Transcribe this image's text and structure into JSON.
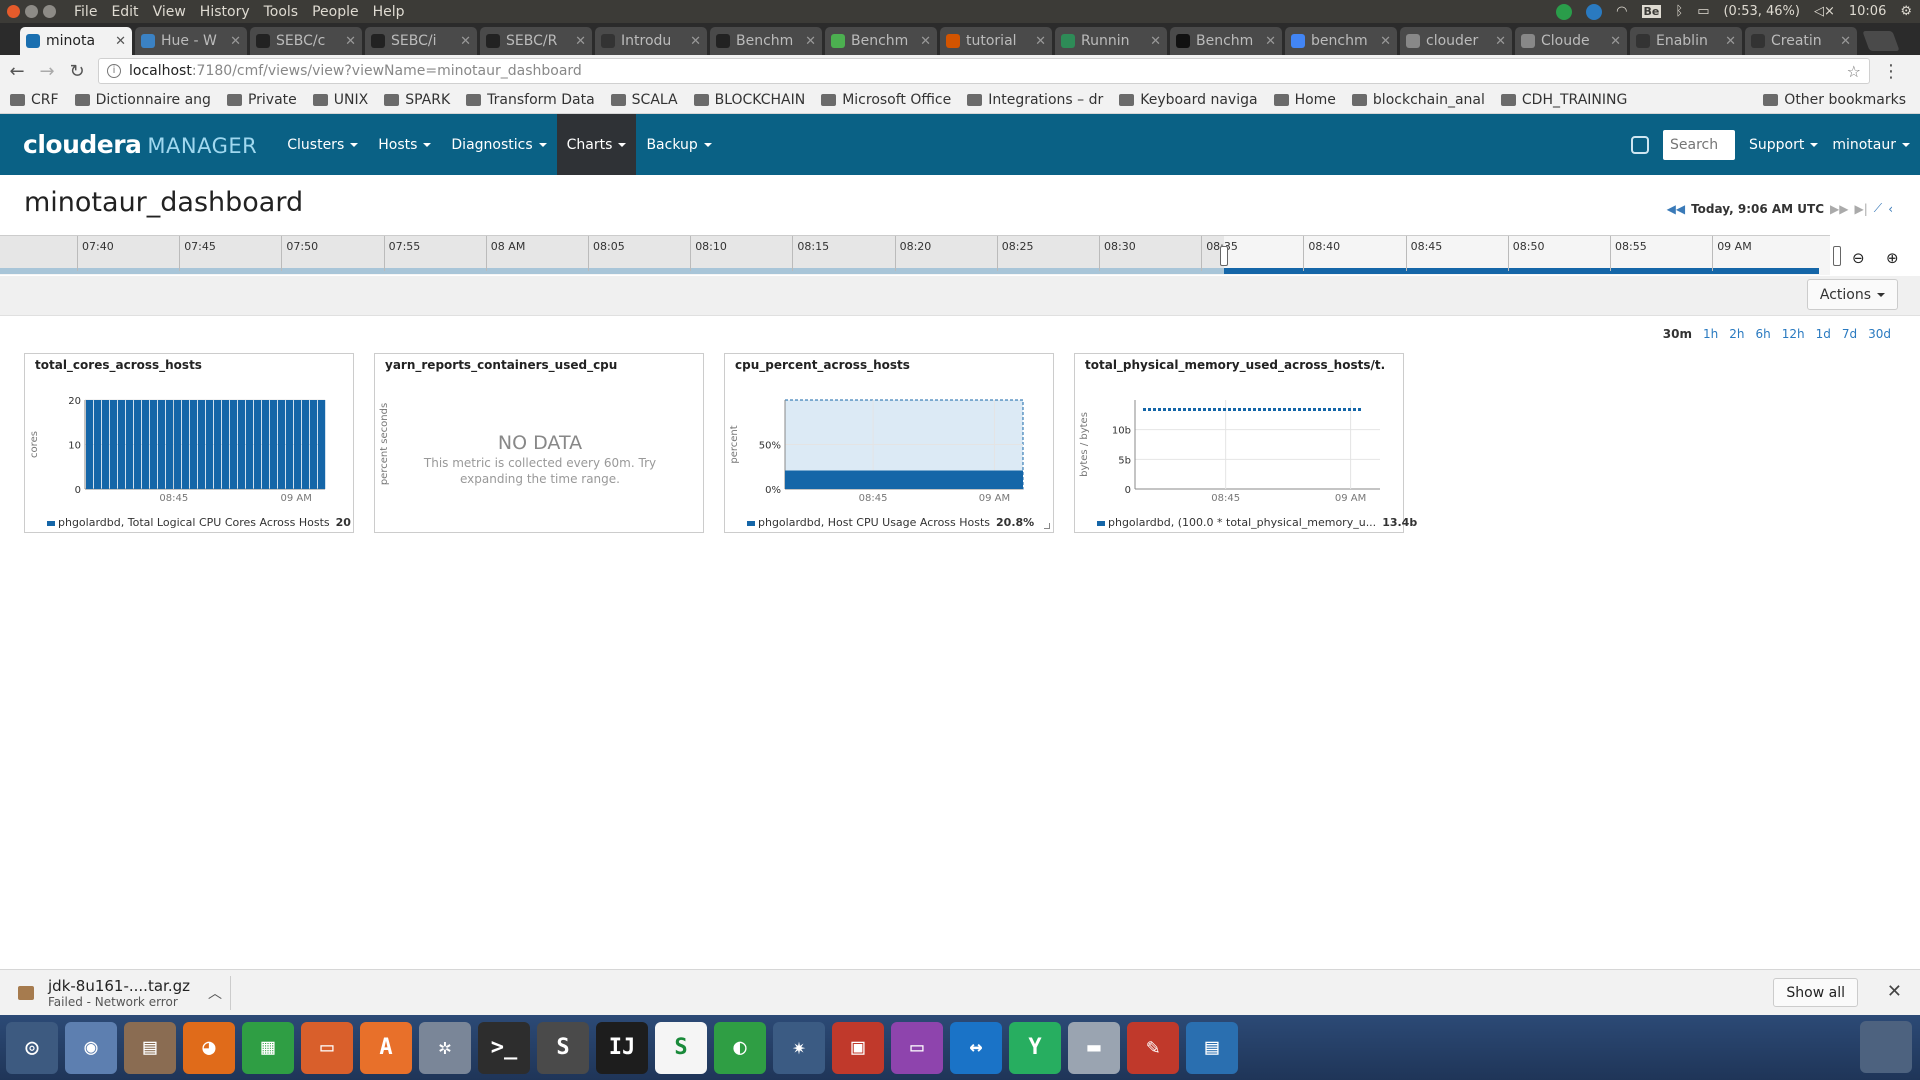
{
  "os_bar": {
    "menu": [
      "File",
      "Edit",
      "View",
      "History",
      "Tools",
      "People",
      "Help"
    ],
    "battery": "(0:53, 46%)",
    "clock": "10:06",
    "keyboard": "Be"
  },
  "tabs": [
    {
      "label": "minota",
      "active": true,
      "icon_color": "#1a6fb0"
    },
    {
      "label": "Hue - W",
      "icon_color": "#3b82c4"
    },
    {
      "label": "SEBC/c",
      "icon_color": "#222222"
    },
    {
      "label": "SEBC/i",
      "icon_color": "#222222"
    },
    {
      "label": "SEBC/R",
      "icon_color": "#222222"
    },
    {
      "label": "Introdu",
      "icon_color": "#333333"
    },
    {
      "label": "Benchm",
      "icon_color": "#222222"
    },
    {
      "label": "Benchm",
      "icon_color": "#4caf50"
    },
    {
      "label": "tutorial",
      "icon_color": "#d35400"
    },
    {
      "label": "Runnin",
      "icon_color": "#2e8b57"
    },
    {
      "label": "Benchm",
      "icon_color": "#111111"
    },
    {
      "label": "benchm",
      "icon_color": "#4285f4"
    },
    {
      "label": "clouder",
      "icon_color": "#888888"
    },
    {
      "label": "Cloude",
      "icon_color": "#888888"
    },
    {
      "label": "Enablin",
      "icon_color": "#333333"
    },
    {
      "label": "Creatin",
      "icon_color": "#333333"
    }
  ],
  "address": {
    "host": "localhost",
    "path": ":7180/cmf/views/view?viewName=minotaur_dashboard"
  },
  "bookmarks": [
    "CRF",
    "Dictionnaire ang",
    "Private",
    "UNIX",
    "SPARK",
    "Transform Data",
    "SCALA",
    "BLOCKCHAIN",
    "Microsoft Office",
    "Integrations – dr",
    "Keyboard naviga",
    "Home",
    "blockchain_anal",
    "CDH_TRAINING"
  ],
  "other_bookmarks": "Other bookmarks",
  "cm": {
    "logo_main": "cloudera",
    "logo_sub": "MANAGER",
    "nav": [
      "Clusters",
      "Hosts",
      "Diagnostics",
      "Charts",
      "Backup"
    ],
    "active_nav": "Charts",
    "search_placeholder": "Search",
    "support": "Support",
    "user": "minotaur"
  },
  "page": {
    "title": "minotaur_dashboard",
    "time_label": "Today, 9:06 AM UTC",
    "actions": "Actions"
  },
  "timeline": {
    "ticks": [
      "07:40",
      "07:45",
      "07:50",
      "07:55",
      "08 AM",
      "08:05",
      "08:10",
      "08:15",
      "08:20",
      "08:25",
      "08:30",
      "08:35",
      "08:40",
      "08:45",
      "08:50",
      "08:55",
      "09 AM"
    ]
  },
  "ranges": [
    "30m",
    "1h",
    "2h",
    "6h",
    "12h",
    "1d",
    "7d",
    "30d"
  ],
  "selected_range": "30m",
  "colors": {
    "header": "#0a6185",
    "series": "#1566a8",
    "link": "#2a7ac0"
  },
  "charts": [
    {
      "title": "total_cores_across_hosts",
      "ylabel": "cores",
      "yticks": [
        "20",
        "10",
        "0"
      ],
      "xticks": [
        "08:45",
        "09 AM"
      ],
      "legend": "phgolardbd, Total Logical CPU Cores Across Hosts",
      "legend_value": "20"
    },
    {
      "title": "yarn_reports_containers_used_cpu",
      "ylabel": "percent seconds",
      "nodata_title": "NO DATA",
      "nodata_msg": "This metric is collected every 60m. Try expanding the time range."
    },
    {
      "title": "cpu_percent_across_hosts",
      "ylabel": "percent",
      "yticks": [
        "50%",
        "0%"
      ],
      "xticks": [
        "08:45",
        "09 AM"
      ],
      "legend": "phgolardbd, Host CPU Usage Across Hosts",
      "legend_value": "20.8%"
    },
    {
      "title": "total_physical_memory_used_across_hosts/t...",
      "ylabel": "bytes / bytes",
      "yticks": [
        "10b",
        "5b",
        "0"
      ],
      "xticks": [
        "08:45",
        "09 AM"
      ],
      "legend": "phgolardbd, (100.0 * total_physical_memory_u...",
      "legend_value": "13.4b"
    }
  ],
  "chart_data": [
    {
      "type": "bar",
      "title": "total_cores_across_hosts",
      "ylabel": "cores",
      "ylim": [
        0,
        20
      ],
      "series": [
        {
          "name": "phgolardbd, Total Logical CPU Cores Across Hosts",
          "values": [
            20,
            20,
            20,
            20,
            20,
            20,
            20,
            20,
            20,
            20,
            20,
            20,
            20,
            20,
            20,
            20,
            20,
            20,
            20,
            20,
            20,
            20,
            20,
            20,
            20,
            20,
            20,
            20,
            20,
            20
          ]
        }
      ]
    },
    {
      "type": "area",
      "title": "cpu_percent_across_hosts",
      "ylabel": "percent",
      "ylim": [
        0,
        100
      ],
      "series": [
        {
          "name": "phgolardbd, Host CPU Usage Across Hosts",
          "values": [
            20.8,
            20.8,
            20.8,
            20.8,
            20.8,
            20.8,
            20.8,
            20.8,
            20.8,
            20.8
          ]
        }
      ]
    },
    {
      "type": "line",
      "title": "total_physical_memory_used_across_hosts/t...",
      "ylabel": "bytes / bytes",
      "ylim": [
        0,
        15
      ],
      "series": [
        {
          "name": "phgolardbd, (100.0 * total_physical_memory_u...",
          "values": [
            13.4,
            13.4,
            13.4,
            13.4,
            13.4,
            13.4,
            13.4,
            13.4,
            13.4,
            13.4
          ]
        }
      ]
    }
  ],
  "download": {
    "file": "jdk-8u161-....tar.gz",
    "status": "Failed - Network error",
    "show_all": "Show all"
  },
  "dock": [
    {
      "name": "ubuntu-dash-icon",
      "color": "#3d5a80",
      "glyph": "◎"
    },
    {
      "name": "chrome-icon",
      "color": "#5d7fb0",
      "glyph": "◉"
    },
    {
      "name": "files-icon",
      "color": "#8a6c52",
      "glyph": "▤"
    },
    {
      "name": "firefox-icon",
      "color": "#e06b1a",
      "glyph": "◕"
    },
    {
      "name": "spreadsheet-icon",
      "color": "#2f9e44",
      "glyph": "▦"
    },
    {
      "name": "presentation-icon",
      "color": "#d95f2b",
      "glyph": "▭"
    },
    {
      "name": "software-center-icon",
      "color": "#e8702a",
      "glyph": "A"
    },
    {
      "name": "settings-icon",
      "color": "#7a8698",
      "glyph": "✲"
    },
    {
      "name": "terminal-icon",
      "color": "#2d2d2d",
      "glyph": ">_"
    },
    {
      "name": "sublime-icon",
      "color": "#4a4a4a",
      "glyph": "S"
    },
    {
      "name": "intellij-icon",
      "color": "#1d1d1d",
      "glyph": "IJ"
    },
    {
      "name": "scala-ide-icon",
      "color": "#f5f5f5",
      "glyph": "S"
    },
    {
      "name": "wireshark-icon",
      "color": "#2f9e44",
      "glyph": "◐"
    },
    {
      "name": "shutter-icon",
      "color": "#3b5b83",
      "glyph": "✷"
    },
    {
      "name": "remote-icon",
      "color": "#c0392b",
      "glyph": "▣"
    },
    {
      "name": "workspace-icon",
      "color": "#8e44ad",
      "glyph": "▭"
    },
    {
      "name": "teamviewer-icon",
      "color": "#1a73c7",
      "glyph": "↔"
    },
    {
      "name": "yed-icon",
      "color": "#27ae60",
      "glyph": "Y"
    },
    {
      "name": "disk-icon",
      "color": "#9aa4b1",
      "glyph": "▬"
    },
    {
      "name": "pdf-reader-icon",
      "color": "#c0392b",
      "glyph": "✎"
    },
    {
      "name": "writer-icon",
      "color": "#2a6fb0",
      "glyph": "▤"
    }
  ]
}
